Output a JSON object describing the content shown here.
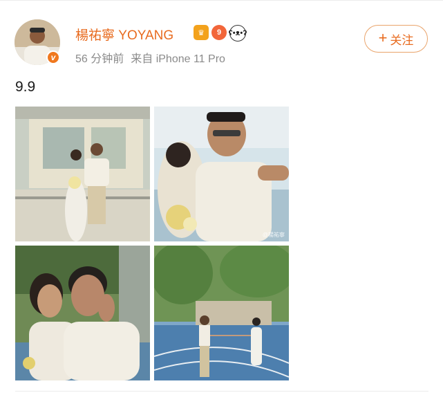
{
  "post": {
    "username": "楊祐寧 YOYANG",
    "time_ago": "56 分钟前",
    "source": "来自 iPhone 11 Pro",
    "follow_label": "关注",
    "text": "9.9",
    "verified_mark": "v",
    "level_badge": "9",
    "photos": [
      {
        "name": "photo-couple-by-shop"
      },
      {
        "name": "photo-selfie-kiss",
        "watermark": "@楊祐寧"
      },
      {
        "name": "photo-laughing-couple"
      },
      {
        "name": "photo-couple-on-track"
      }
    ]
  },
  "colors": {
    "accent": "#e86b1f",
    "meta_gray": "#8a8a8a"
  },
  "icons": [
    "crown-badge-icon",
    "level-badge-icon",
    "panda-badge-icon",
    "plus-icon",
    "verified-icon"
  ]
}
